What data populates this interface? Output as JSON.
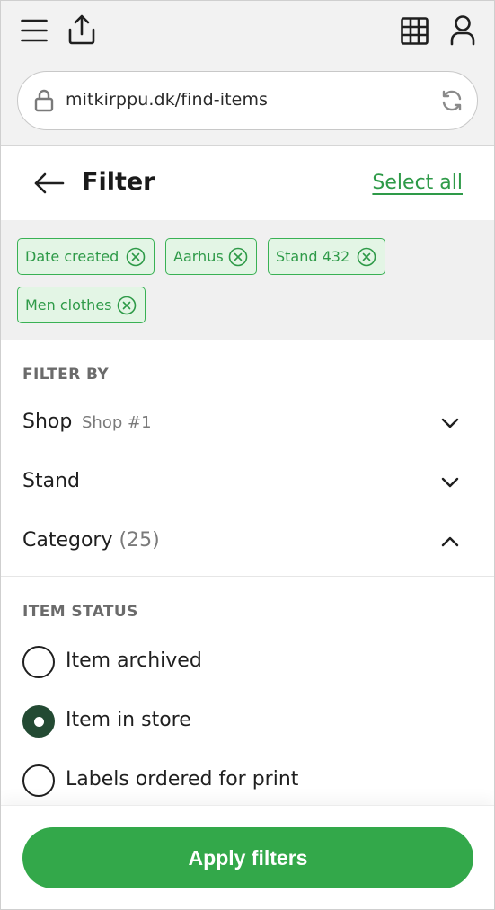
{
  "browser": {
    "url": "mitkirppu.dk/find-items",
    "menu_icon": "menu-icon",
    "share_icon": "share-icon",
    "grid_icon": "grid-icon",
    "account_icon": "user-icon",
    "lock_icon": "lock-icon",
    "reload_icon": "reload-icon"
  },
  "header": {
    "title": "Filter",
    "select_all": "Select all",
    "back_icon": "arrow-left-icon"
  },
  "chips": [
    {
      "label": "Date created"
    },
    {
      "label": "Aarhus"
    },
    {
      "label": "Stand 432"
    },
    {
      "label": "Men clothes"
    }
  ],
  "filter_by": {
    "heading": "FILTER BY",
    "rows": [
      {
        "label": "Shop",
        "value": "Shop #1",
        "state": "collapsed"
      },
      {
        "label": "Stand",
        "value": "",
        "state": "collapsed"
      },
      {
        "label": "Category",
        "count": "(25)",
        "state": "expanded"
      }
    ]
  },
  "item_status": {
    "heading": "ITEM STATUS",
    "options": [
      {
        "label": "Item archived",
        "checked": false
      },
      {
        "label": "Item in store",
        "checked": true
      },
      {
        "label": "Labels ordered for print",
        "checked": false
      }
    ]
  },
  "footer": {
    "apply_label": "Apply filters"
  },
  "colors": {
    "accent": "#33a84a",
    "chip_bg": "#e3f5e5",
    "chip_border": "#39b154",
    "radio_checked": "#234a33"
  }
}
